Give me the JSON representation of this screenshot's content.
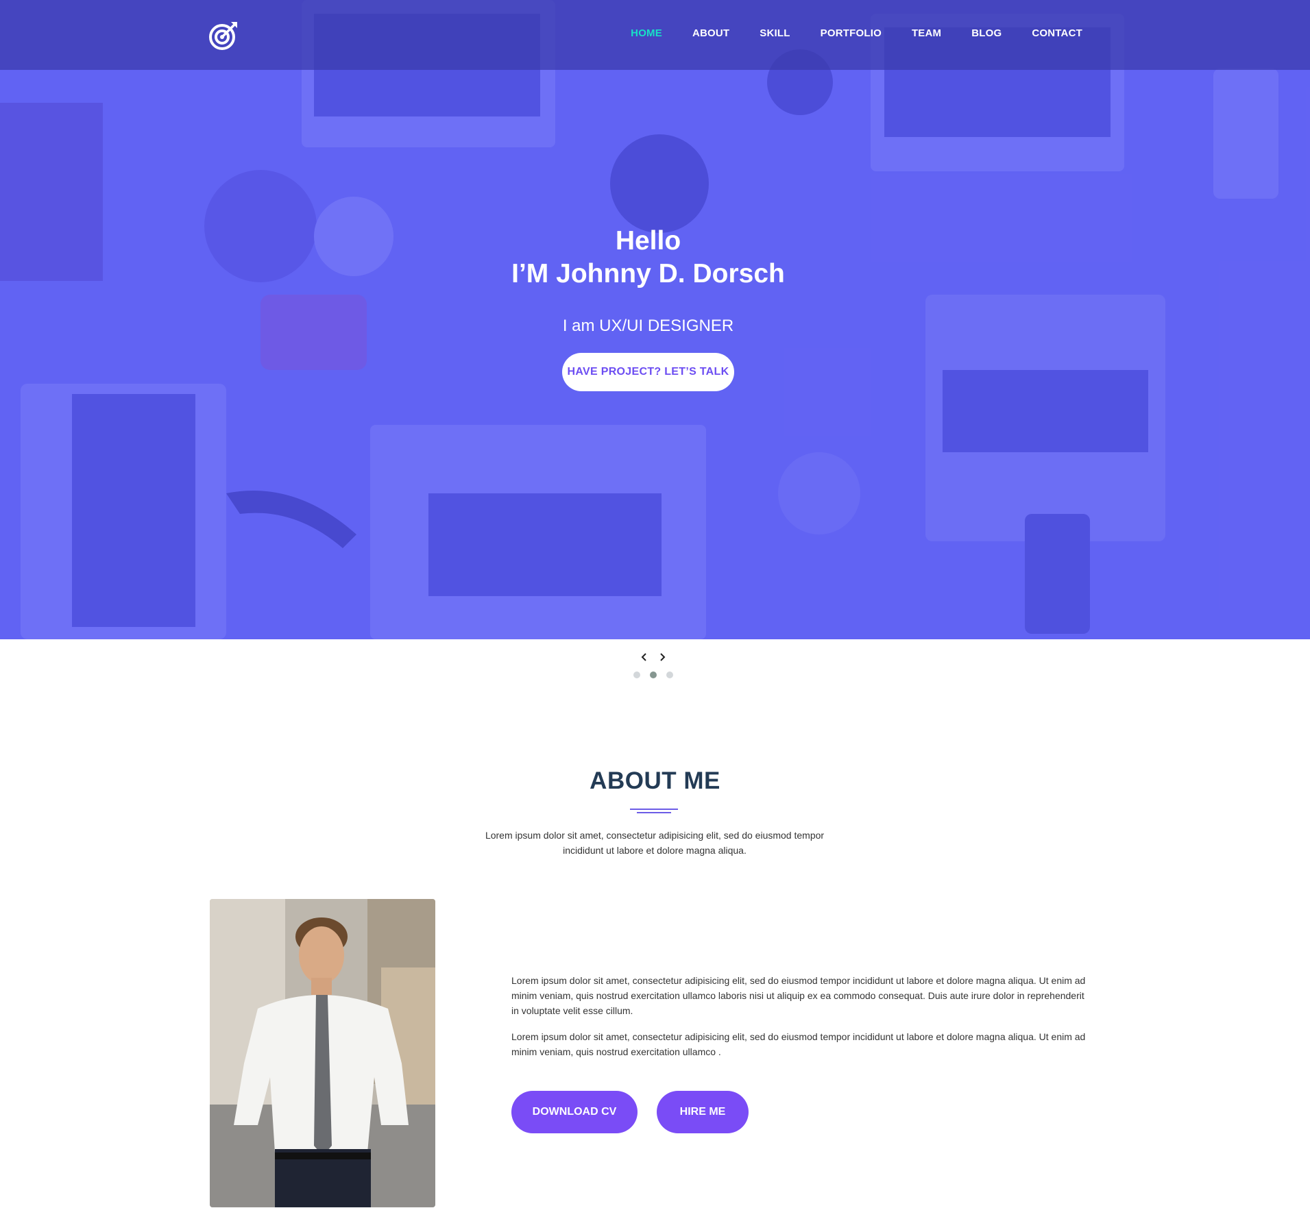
{
  "nav": {
    "logo_icon": "target-arrow-icon",
    "items": [
      {
        "label": "HOME",
        "active": true
      },
      {
        "label": "ABOUT",
        "active": false
      },
      {
        "label": "SKILL",
        "active": false
      },
      {
        "label": "PORTFOLIO",
        "active": false
      },
      {
        "label": "TEAM",
        "active": false
      },
      {
        "label": "BLOG",
        "active": false
      },
      {
        "label": "CONTACT",
        "active": false
      }
    ]
  },
  "hero": {
    "line1": "Hello",
    "line2": "I’M Johnny D. Dorsch",
    "subtitle": "I am UX/UI DESIGNER",
    "cta": "HAVE PROJECT? LET’S TALK"
  },
  "slider": {
    "prev_icon": "chevron-left-icon",
    "next_icon": "chevron-right-icon",
    "dots": 3,
    "active_dot": 2
  },
  "about": {
    "title": "ABOUT ME",
    "intro": "Lorem ipsum dolor sit amet, consectetur adipisicing elit, sed do eiusmod tempor incididunt ut labore et dolore magna aliqua.",
    "paragraph1": "Lorem ipsum dolor sit amet, consectetur adipisicing elit, sed do eiusmod tempor incididunt ut labore et dolore magna aliqua. Ut enim ad minim veniam, quis nostrud exercitation ullamco laboris nisi ut aliquip ex ea commodo consequat. Duis aute irure dolor in reprehenderit in voluptate velit esse cillum.",
    "paragraph2": "Lorem ipsum dolor sit amet, consectetur adipisicing elit, sed do eiusmod tempor incididunt ut labore et dolore magna aliqua. Ut enim ad minim veniam, quis nostrud exercitation ullamco .",
    "download_button": "DOWNLOAD CV",
    "hire_button": "HIRE ME"
  },
  "colors": {
    "hero_overlay": "#585af6",
    "nav_active": "#18e0c7",
    "accent": "#7a4cf6",
    "heading": "#233b55"
  }
}
